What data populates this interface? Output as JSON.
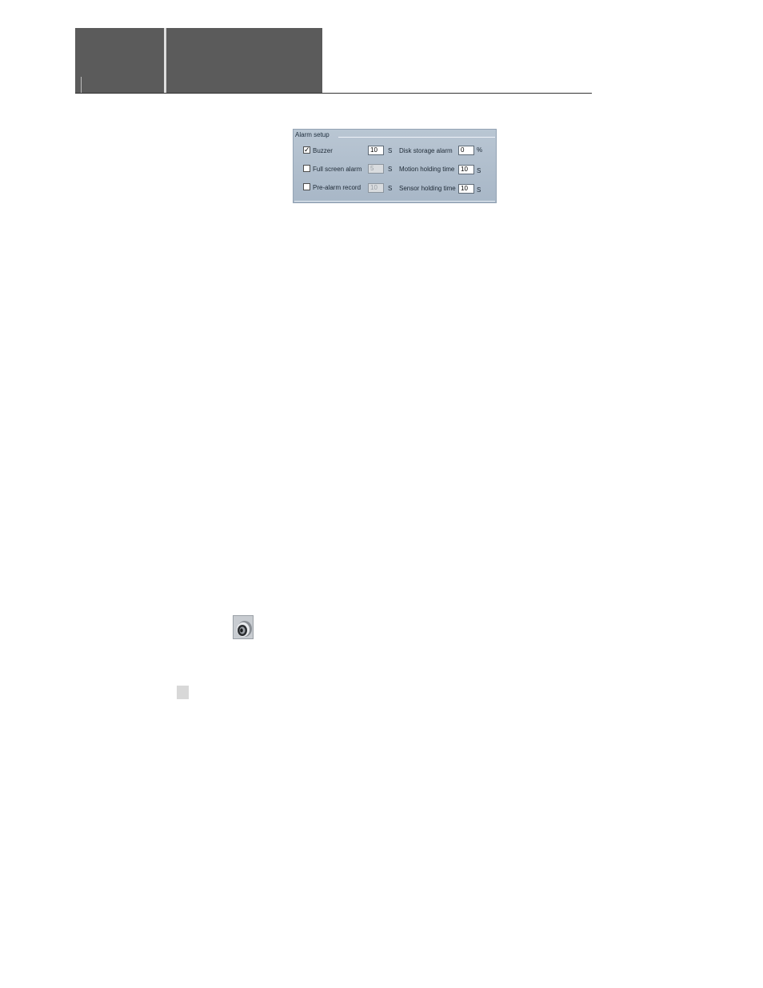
{
  "alarm_setup": {
    "legend": "Alarm setup",
    "buzzer": {
      "label": "Buzzer",
      "checked": true,
      "check_mark": "✓",
      "value": "10",
      "unit": "S"
    },
    "full_screen_alarm": {
      "label": "Full screen alarm",
      "checked": false,
      "value": "5",
      "unit": "S"
    },
    "pre_alarm_record": {
      "label": "Pre-alarm record",
      "checked": false,
      "value": "10",
      "unit": "S"
    },
    "disk_storage_alarm": {
      "label": "Disk storage alarm",
      "value": "0",
      "unit": "%"
    },
    "motion_holding_time": {
      "label": "Motion holding time",
      "value": "10",
      "unit": "S"
    },
    "sensor_holding_time": {
      "label": "Sensor holding time",
      "value": "10",
      "unit": "S"
    }
  },
  "icons": {
    "speaker": "speaker-icon"
  }
}
